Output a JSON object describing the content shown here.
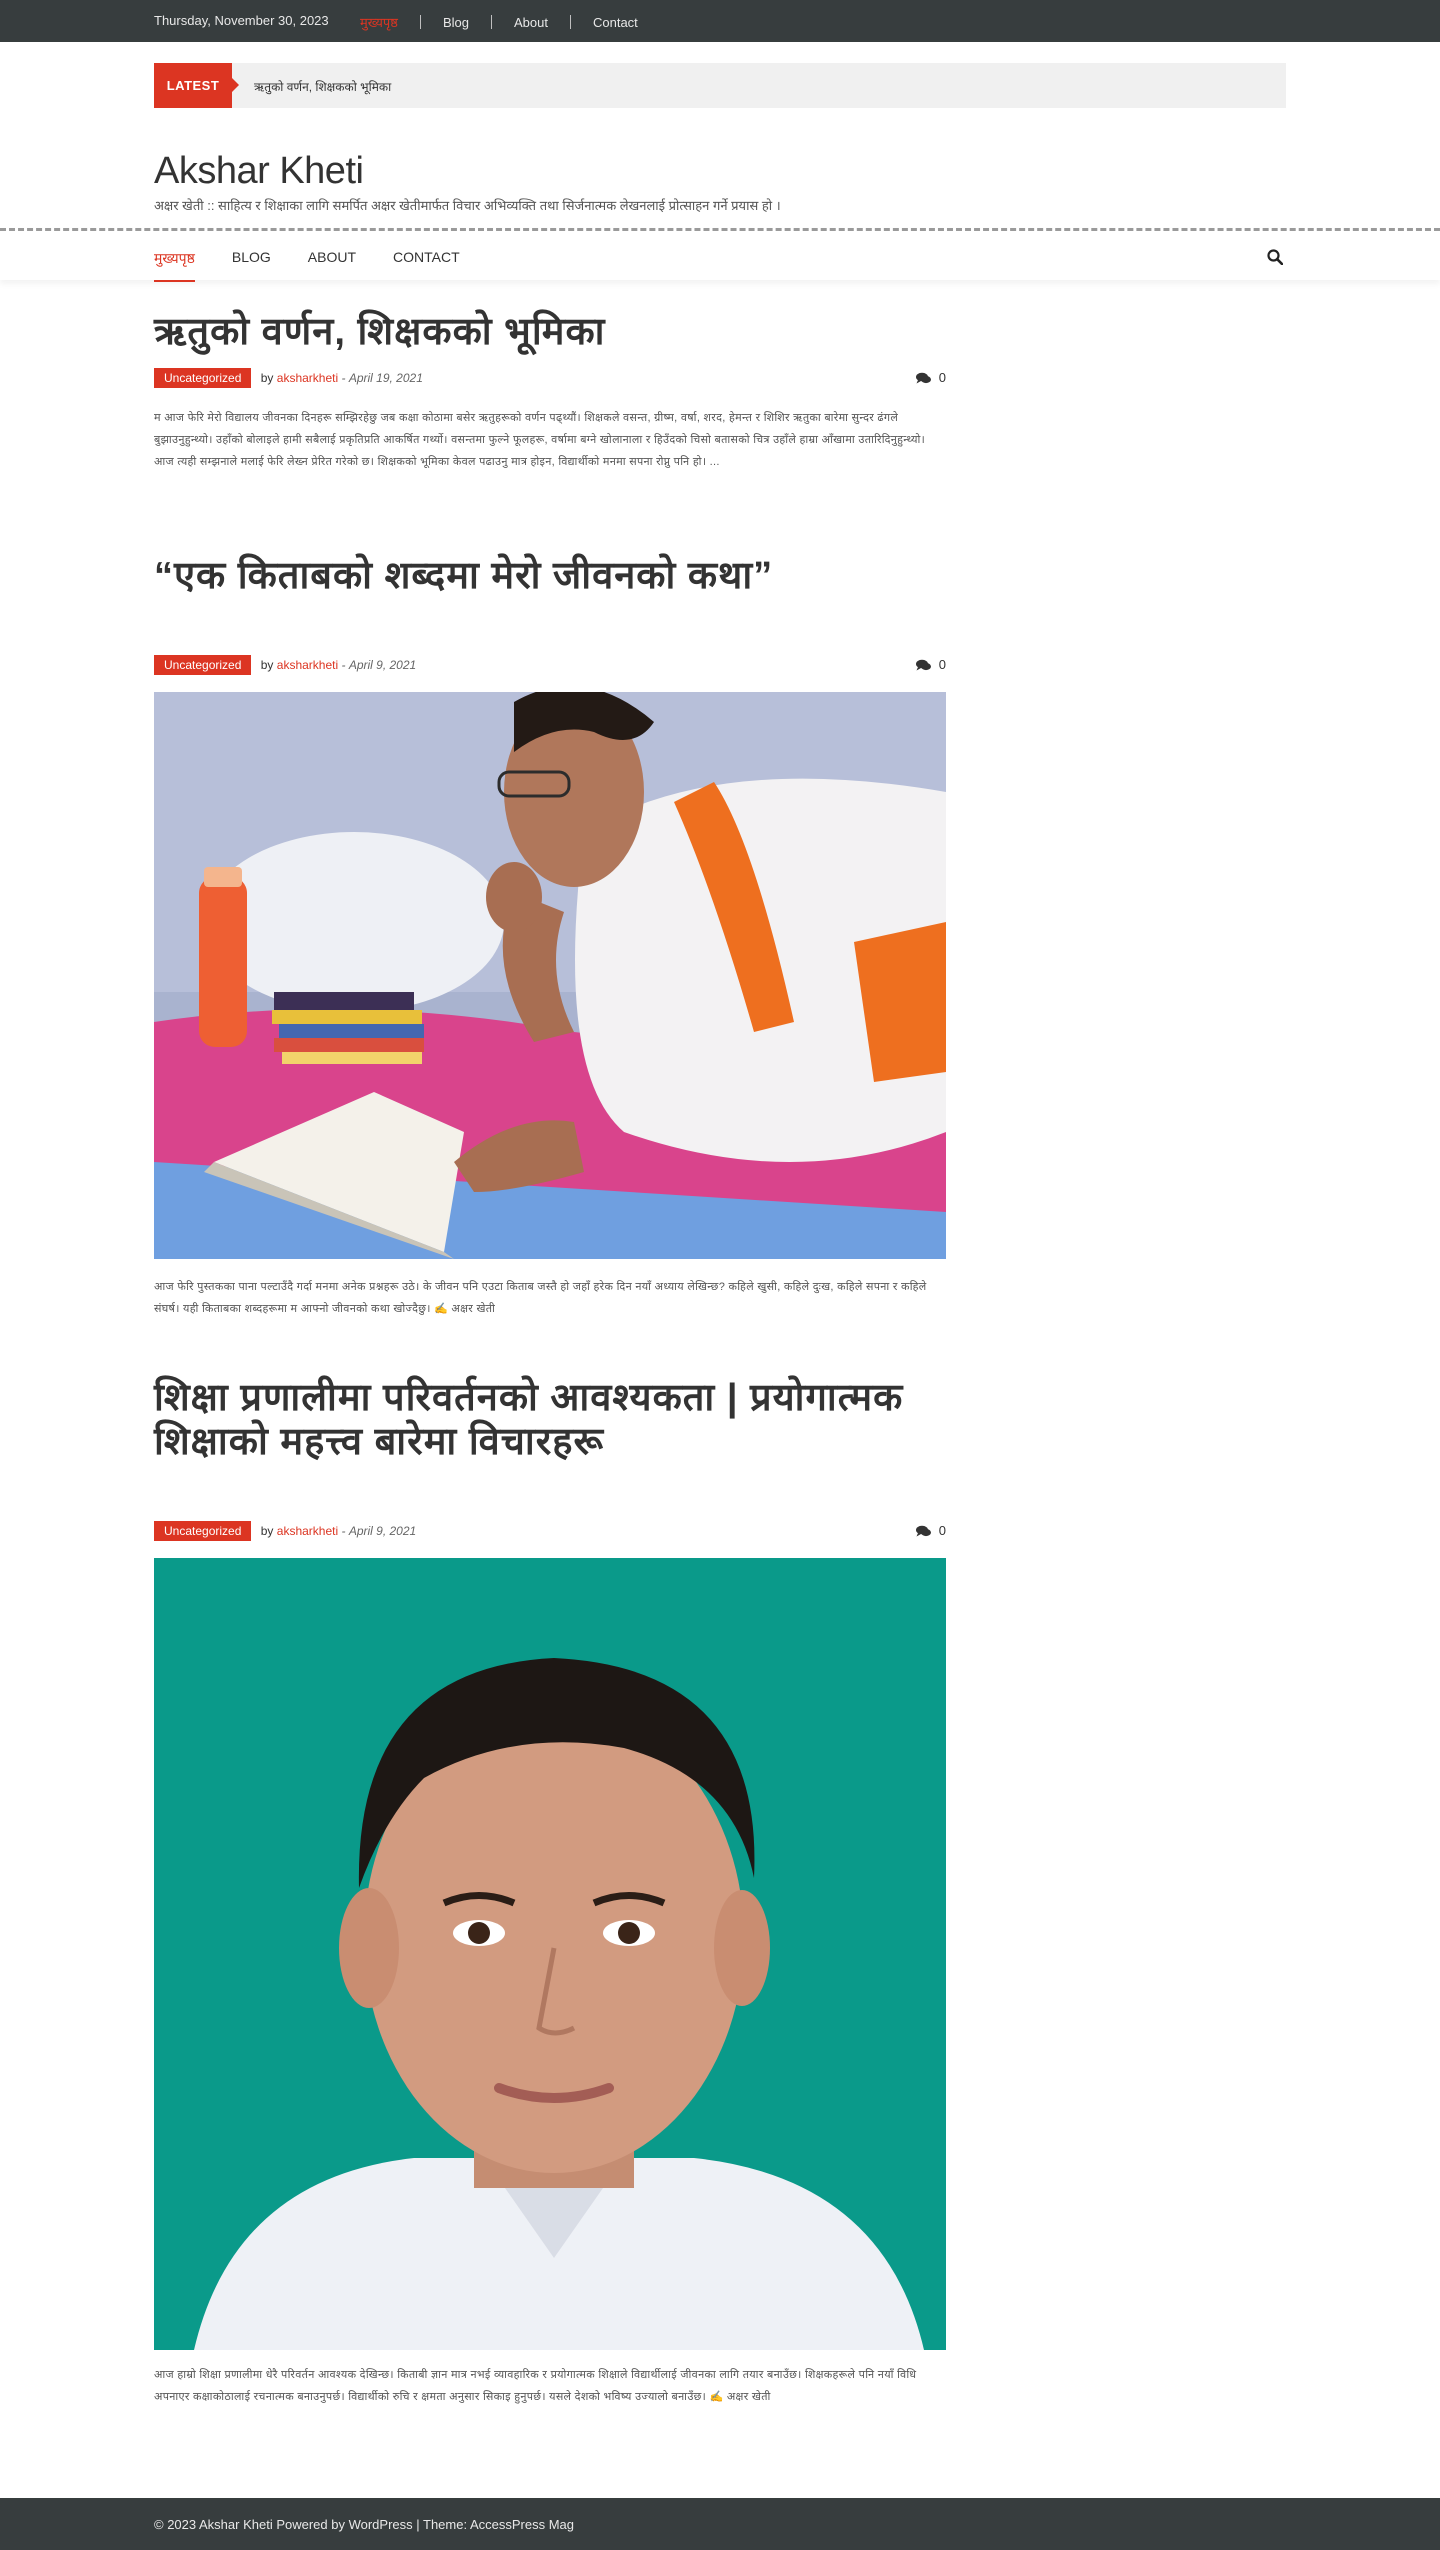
{
  "topbar": {
    "date": "Thursday, November 30, 2023",
    "links": [
      "मुख्यपृष्ठ",
      "Blog",
      "About",
      "Contact"
    ]
  },
  "ticker": {
    "label": "LATEST",
    "text": "ऋतुको वर्णन, शिक्षकको भूमिका"
  },
  "site": {
    "title": "Akshar Kheti",
    "description": "अक्षर खेती :: साहित्य र शिक्षाका लागि समर्पित अक्षर खेतीमार्फत विचार अभिव्यक्ति तथा सिर्जनात्मक लेखनलाई प्रोत्साहन गर्ने प्रयास हो ।"
  },
  "nav": {
    "items": [
      "मुख्यपृष्ठ",
      "Blog",
      "About",
      "Contact"
    ]
  },
  "posts": [
    {
      "title": "ऋतुको वर्णन, शिक्षकको भूमिका",
      "category": "Uncategorized",
      "by": "by",
      "author": "aksharkheti",
      "date": "April 19, 2021",
      "comments": "0",
      "excerpt": "म आज फेरि मेरो विद्यालय जीवनका दिनहरू सम्झिरहेछु जब कक्षा कोठामा बसेर ऋतुहरूको वर्णन पढ्थ्यौं। शिक्षकले वसन्त, ग्रीष्म, वर्षा, शरद, हेमन्त र शिशिर ऋतुका बारेमा सुन्दर ढंगले बुझाउनुहुन्थ्यो। उहाँको बोलाइले हामी सबैलाई प्रकृतिप्रति आकर्षित गर्थ्यो। वसन्तमा फुल्ने फूलहरू, वर्षामा बग्ने खोलानाला र हिउँदको चिसो बतासको चित्र उहाँले हाम्रा आँखामा उतारिदिनुहुन्थ्यो। आज त्यही सम्झनाले मलाई फेरि लेख्न प्रेरित गरेको छ। शिक्षकको भूमिका केवल पढाउनु मात्र होइन, विद्यार्थीको मनमा सपना रोप्नु पनि हो। ..."
    },
    {
      "title": "“एक किताबको शब्दमा मेरो जीवनको कथा”",
      "category": "Uncategorized",
      "by": "by",
      "author": "aksharkheti",
      "date": "April 9, 2021",
      "comments": "0",
      "excerpt": "आज फेरि पुस्तकका पाना पल्टाउँदै गर्दा मनमा अनेक प्रश्नहरू उठे। के जीवन पनि एउटा किताब जस्तै हो जहाँ हरेक दिन नयाँ अध्याय लेखिन्छ? कहिले खुसी, कहिले दुःख, कहिले सपना र कहिले संघर्ष। यही किताबका शब्दहरूमा म आफ्नो जीवनको कथा खोज्दैछु। ✍️ अक्षर खेती"
    },
    {
      "title": "शिक्षा प्रणालीमा परिवर्तनको आवश्यकता | प्रयोगात्मक शिक्षाको महत्त्व बारेमा विचारहरू",
      "category": "Uncategorized",
      "by": "by",
      "author": "aksharkheti",
      "date": "April 9, 2021",
      "comments": "0",
      "excerpt": "आज हाम्रो शिक्षा प्रणालीमा धेरै परिवर्तन आवश्यक देखिन्छ। किताबी ज्ञान मात्र नभई व्यावहारिक र प्रयोगात्मक शिक्षाले विद्यार्थीलाई जीवनका लागि तयार बनाउँछ। शिक्षकहरूले पनि नयाँ विधि अपनाएर कक्षाकोठालाई रचनात्मक बनाउनुपर्छ। विद्यार्थीको रुचि र क्षमता अनुसार सिकाइ हुनुपर्छ। यसले देशको भविष्य उज्यालो बनाउँछ। ✍️ अक्षर खेती"
    }
  ],
  "footer": {
    "text": "© 2023 Akshar Kheti Powered by WordPress | Theme: AccessPress Mag"
  },
  "colors": {
    "accent": "#dc3522",
    "dark_bar": "#373d3e",
    "ticker_bg": "#f0f0f0",
    "photo2_bg": "#0a9a8a"
  },
  "icons": {
    "search": "search-icon",
    "comments": "comments-icon",
    "ticker_arrow": "arrow-right-icon"
  }
}
